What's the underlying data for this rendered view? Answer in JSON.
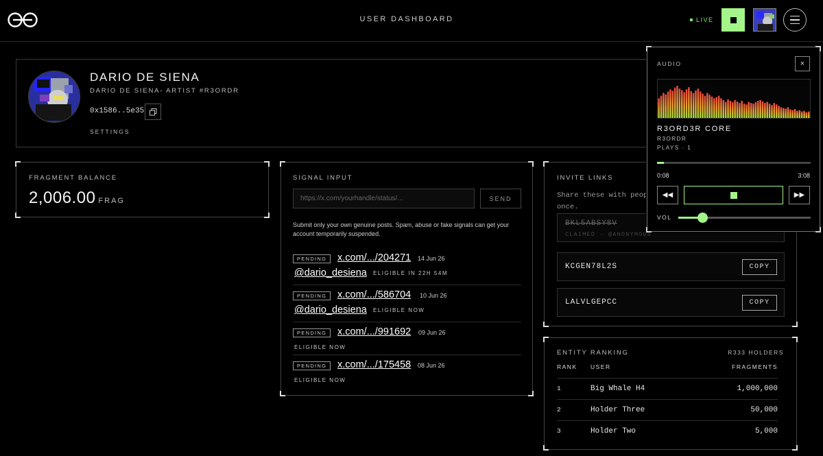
{
  "header": {
    "title": "USER DASHBOARD",
    "live_label": "LIVE",
    "logo_icon": "infinity-logo-icon",
    "accent": "#a3f58a"
  },
  "profile": {
    "name": "DARIO DE SIENA",
    "subtitle": "DARIO DE SIENA- ARTIST #R3ORDR",
    "wallet": "0x1586..5e35",
    "settings_label": "SETTINGS"
  },
  "balance": {
    "label": "FRAGMENT BALANCE",
    "value": "2,006.00",
    "unit": "FRAG"
  },
  "signal": {
    "label": "SIGNAL INPUT",
    "placeholder": "https://x.com/yourhandle/status/...",
    "send_label": "SEND",
    "note": "Submit only your own genuine posts. Spam, abuse or fake signals can get your account temporarily suspended.",
    "items": [
      {
        "status": "PENDING",
        "link": "x.com/.../204271",
        "date": "14 Jun 26",
        "handle": "@dario_desiena",
        "eligibility": "ELIGIBLE IN 22H 54M"
      },
      {
        "status": "PENDING",
        "link": "x.com/.../586704",
        "date": "10 Jun 26",
        "handle": "@dario_desiena",
        "eligibility": "ELIGIBLE NOW"
      },
      {
        "status": "PENDING",
        "link": "x.com/.../991692",
        "date": "09 Jun 26",
        "handle": "",
        "eligibility": "ELIGIBLE NOW"
      },
      {
        "status": "PENDING",
        "link": "x.com/.../175458",
        "date": "08 Jun 26",
        "handle": "",
        "eligibility": "ELIGIBLE NOW"
      }
    ]
  },
  "invite": {
    "label": "INVITE LINKS",
    "description": "Share these with peop once.",
    "codes": [
      {
        "code": "BKL5ABSY8V",
        "claimed": true,
        "meta": "CLAIMED · @ANONYMOUS"
      },
      {
        "code": "KCGEN78L2S",
        "claimed": false,
        "copy_label": "COPY"
      },
      {
        "code": "LALVLGEPCC",
        "claimed": false,
        "copy_label": "COPY"
      }
    ]
  },
  "ranking": {
    "label": "ENTITY RANKING",
    "holders": "R333 HOLDERS",
    "columns": {
      "rank": "RANK",
      "user": "USER",
      "fragments": "FRAGMENTS"
    },
    "rows": [
      {
        "rank": "1",
        "user": "Big Whale H4",
        "fragments": "1,000,000"
      },
      {
        "rank": "2",
        "user": "Holder Three",
        "fragments": "50,000"
      },
      {
        "rank": "3",
        "user": "Holder Two",
        "fragments": "5,000"
      }
    ]
  },
  "audio": {
    "label": "AUDIO",
    "close_label": "×",
    "track": "R3ORD3R CORE",
    "artist": "R3ORDR",
    "plays": "PLAYS · 1",
    "current_time": "0:08",
    "duration": "3:08",
    "progress_fraction": 0.043,
    "volume_label": "VOL",
    "volume_fraction": 0.18,
    "prev_icon": "rewind-icon",
    "next_icon": "fast-forward-icon",
    "visualizer_levels": [
      0.55,
      0.62,
      0.7,
      0.66,
      0.74,
      0.8,
      0.76,
      0.85,
      0.9,
      0.82,
      0.78,
      0.72,
      0.8,
      0.86,
      0.75,
      0.7,
      0.77,
      0.82,
      0.74,
      0.68,
      0.62,
      0.7,
      0.65,
      0.6,
      0.55,
      0.58,
      0.62,
      0.55,
      0.5,
      0.45,
      0.52,
      0.48,
      0.44,
      0.5,
      0.46,
      0.42,
      0.48,
      0.4,
      0.38,
      0.45,
      0.42,
      0.4,
      0.44,
      0.48,
      0.5,
      0.46,
      0.42,
      0.45,
      0.4,
      0.36,
      0.42,
      0.38,
      0.34,
      0.3,
      0.28,
      0.26,
      0.3,
      0.24,
      0.22,
      0.25,
      0.2,
      0.22,
      0.18,
      0.2,
      0.16,
      0.18
    ]
  }
}
